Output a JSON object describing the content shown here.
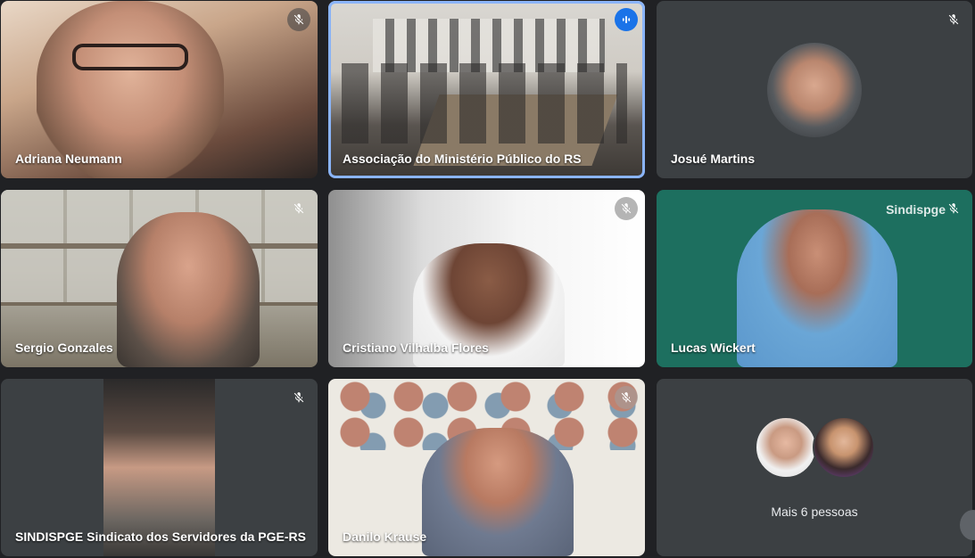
{
  "participants": [
    {
      "name": "Adriana Neumann",
      "muted": true
    },
    {
      "name": "Associação do Ministério Público do RS",
      "speaking": true
    },
    {
      "name": "Josué Martins",
      "muted": true
    },
    {
      "name": "Sergio Gonzales",
      "muted": true
    },
    {
      "name": "Cristiano Vilhalba Flores",
      "muted": true
    },
    {
      "name": "Lucas Wickert",
      "muted": true,
      "watermark": "Sindispge"
    },
    {
      "name": "SINDISPGE Sindicato dos Servidores da PGE-RS",
      "muted": true
    },
    {
      "name": "Danilo Krause",
      "muted": true
    }
  ],
  "overflow": {
    "label": "Mais 6 pessoas"
  },
  "colors": {
    "background": "#202124",
    "tile": "#3c4043",
    "active_outline": "#8ab4f8",
    "speaking": "#1a73e8",
    "green_bg": "#1d6f5f"
  },
  "icons": {
    "muted": "mic-off-icon",
    "speaking": "audio-level-icon"
  }
}
